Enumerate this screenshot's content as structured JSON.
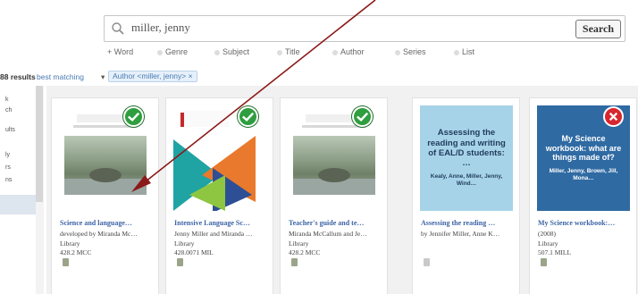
{
  "search": {
    "value": "miller, jenny",
    "button_label": "Search"
  },
  "filters": [
    "Word",
    "Genre",
    "Subject",
    "Title",
    "Author",
    "Series",
    "List"
  ],
  "filters_prefix": "+",
  "results": {
    "count_label": "88 results",
    "sort_label": "best matching",
    "caret": "▾",
    "active_filter": "Author <miller, jenny> ×"
  },
  "left_panel": {
    "items": [
      "k",
      "ch",
      "ults",
      "ly",
      "rs",
      "ns"
    ]
  },
  "cards": [
    {
      "title": "Science and language…",
      "line1": "developed by Miranda Mc…",
      "line2": "Library",
      "line3": "428.2 MCC",
      "badge": "check"
    },
    {
      "title": "Intensive Language Sc…",
      "line1": "Jenny Miller and Miranda …",
      "line2": "Library",
      "line3": "428.0071 MIL",
      "badge": "check"
    },
    {
      "title": "Teacher's guide and te…",
      "line1": "Miranda McCallum and Je…",
      "line2": "Library",
      "line3": "428.2 MCC",
      "badge": "check"
    },
    {
      "title": "Assessing the reading …",
      "line1": "by Jennifer Miller, Anne K…",
      "line2": "",
      "line3": "",
      "cover_title": "Assessing the reading and writing of EAL/D students: …",
      "cover_sub": "Kealy, Anne, Miller, Jenny, Wind…",
      "badge": "none"
    },
    {
      "title": "My Science workbook:…",
      "line1": "(2008)",
      "line2": "Library",
      "line3": "507.1 MILL",
      "cover_title": "My Science workbook: what are things made of?",
      "cover_sub": "Miller, Jenny, Brown, Jill, Mona…",
      "badge": "remove"
    }
  ],
  "colors": {
    "accent": "#3c64a6",
    "check": "#2e9e3e",
    "remove": "#d8262e",
    "arrow": "#8b1a1a",
    "cover_light_blue": "#a7d3e8",
    "cover_dark_blue": "#2f6aa3"
  }
}
